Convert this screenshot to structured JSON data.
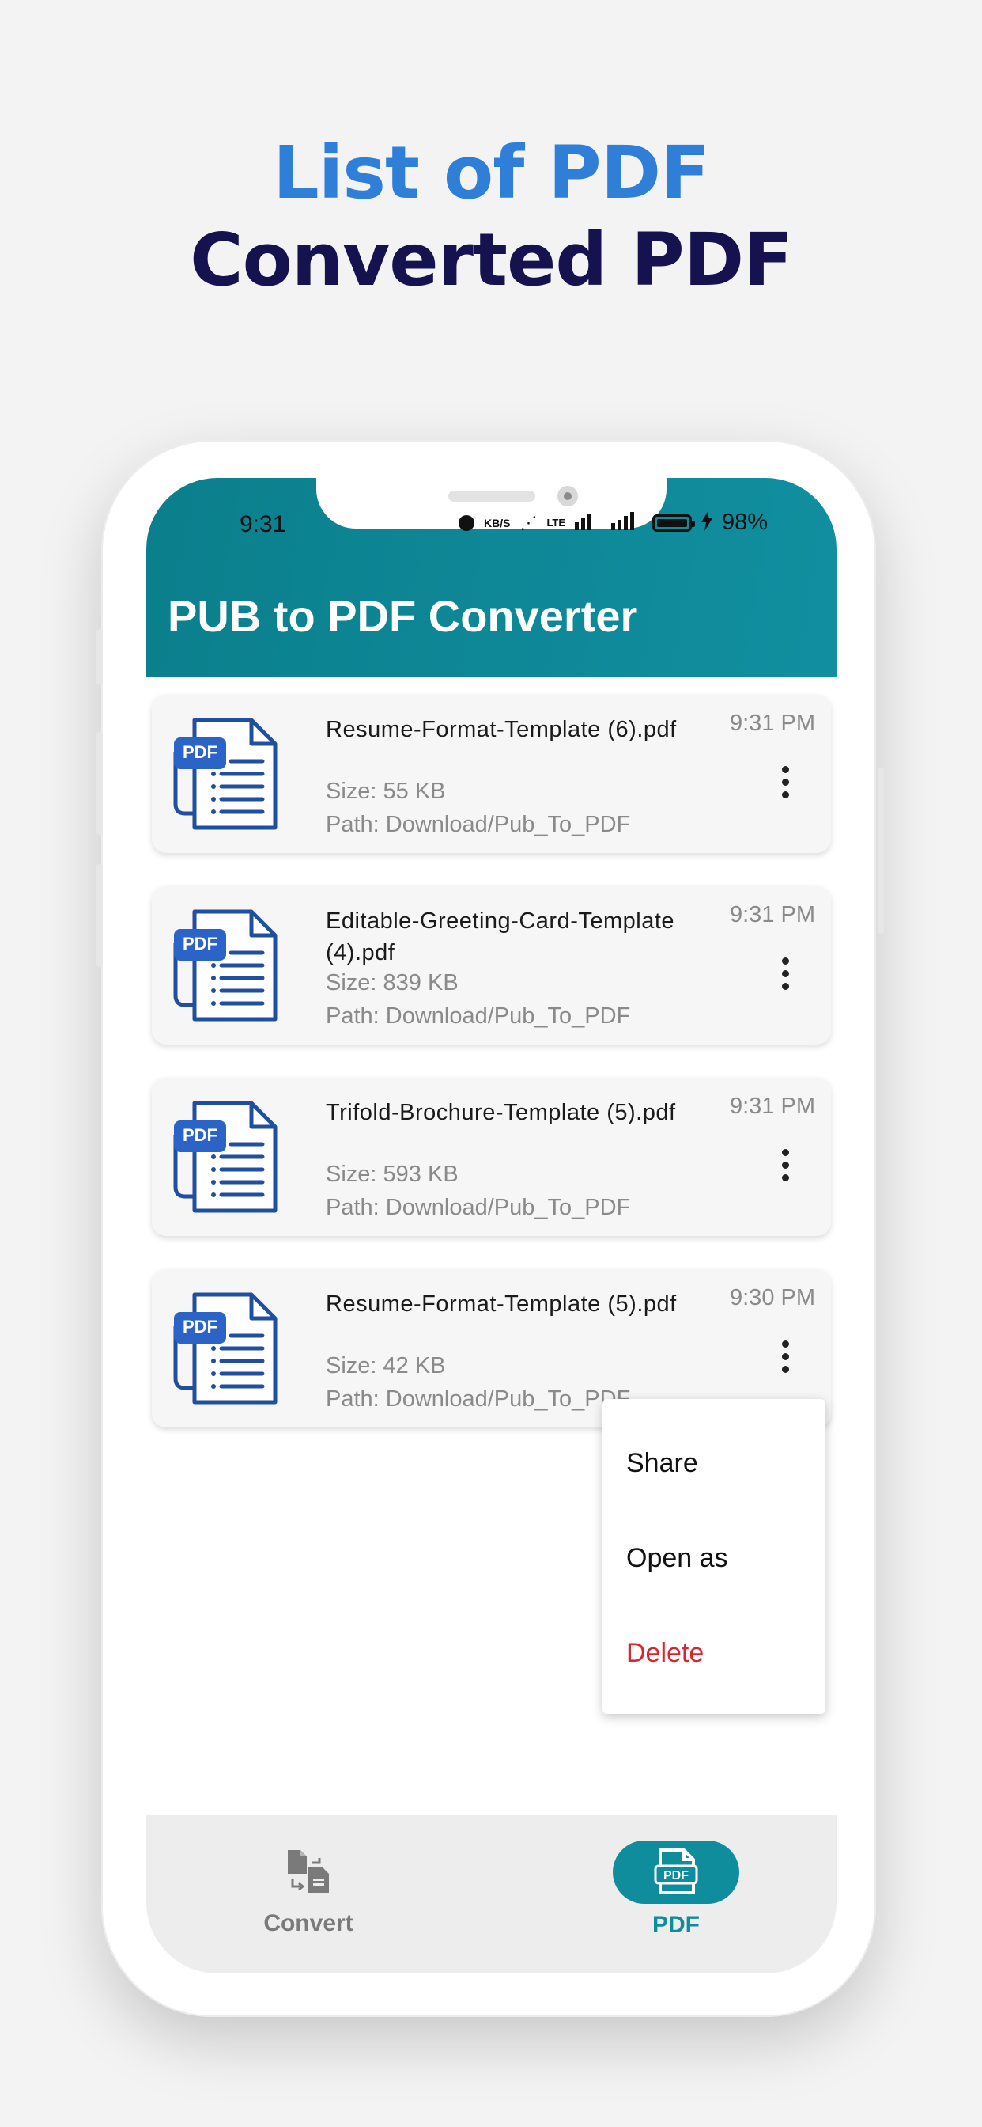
{
  "promo": {
    "line1": "List of PDF",
    "line2": "Converted PDF"
  },
  "status_bar": {
    "time": "9:31",
    "net_speed": "KB/S",
    "network": "LTE",
    "battery": "98%"
  },
  "app": {
    "title": "PUB to PDF Converter"
  },
  "files": [
    {
      "name": "Resume-Format-Template (6).pdf",
      "size": "Size: 55 KB",
      "path": "Path: Download/Pub_To_PDF",
      "time": "9:31 PM",
      "icon": "pdf-file-icon"
    },
    {
      "name": "Editable-Greeting-Card-Template (4).pdf",
      "size": "Size: 839 KB",
      "path": "Path: Download/Pub_To_PDF",
      "time": "9:31 PM",
      "icon": "pdf-file-icon"
    },
    {
      "name": "Trifold-Brochure-Template (5).pdf",
      "size": "Size: 593 KB",
      "path": "Path: Download/Pub_To_PDF",
      "time": "9:31 PM",
      "icon": "pdf-file-icon"
    },
    {
      "name": "Resume-Format-Template (5).pdf",
      "size": "Size: 42 KB",
      "path": "Path: Download/Pub_To_PDF",
      "time": "9:30 PM",
      "icon": "pdf-file-icon"
    }
  ],
  "doc_badge": "PDF",
  "context_menu": {
    "share": "Share",
    "open_as": "Open as",
    "delete": "Delete"
  },
  "nav": {
    "convert": "Convert",
    "pdf": "PDF",
    "pdf_icon_text": "PDF"
  },
  "colors": {
    "accent": "#0f8d9c",
    "headline_blue": "#2f7fd9",
    "headline_navy": "#15124f",
    "delete_red": "#d9262c"
  }
}
